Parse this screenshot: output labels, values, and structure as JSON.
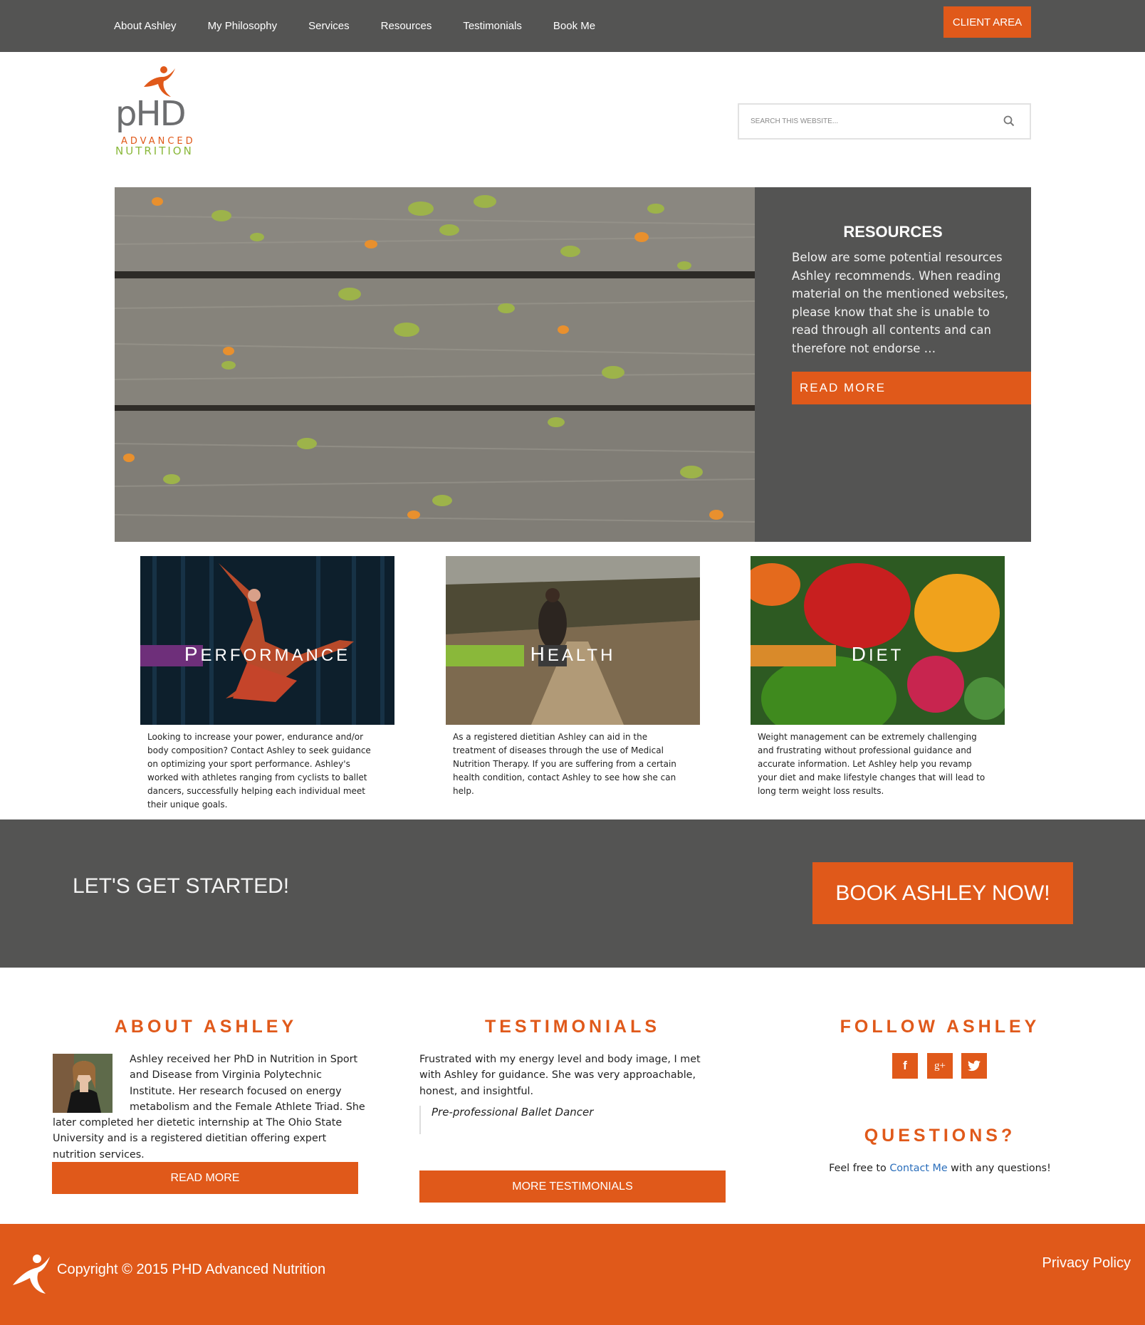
{
  "nav": {
    "items": [
      {
        "label": "About Ashley"
      },
      {
        "label": "My Philosophy"
      },
      {
        "label": "Services"
      },
      {
        "label": "Resources"
      },
      {
        "label": "Testimonials"
      },
      {
        "label": "Book Me"
      }
    ],
    "client_area": "CLIENT AREA"
  },
  "logo": {
    "line1": "pHD",
    "line2": "ADVANCED",
    "line3": "NUTRITION"
  },
  "search": {
    "placeholder": "SEARCH THIS WEBSITE..."
  },
  "hero": {
    "title": "RESOURCES",
    "text": "Below are some potential resources Ashley recommends. When reading material on the mentioned websites, please know that she is unable to read through all contents and can therefore not endorse …",
    "button": "READ MORE"
  },
  "cards": [
    {
      "label_first": "P",
      "label_rest": "ERFORMANCE",
      "text": "Looking to increase your power, endurance and/or body composition? Contact Ashley to seek guidance on optimizing your sport performance. Ashley's worked with athletes ranging from cyclists to ballet dancers, successfully helping each individual meet their unique goals."
    },
    {
      "label_first": "H",
      "label_rest": "EALTH",
      "text": "As a registered dietitian Ashley can aid in the treatment of diseases through the use of Medical Nutrition Therapy. If you are suffering from a certain health condition, contact Ashley to see how she can help."
    },
    {
      "label_first": "D",
      "label_rest": "IET",
      "text": "Weight management can be extremely challenging and frustrating without professional guidance and accurate information. Let Ashley help you revamp your diet and make lifestyle changes that will lead to long term weight loss results."
    }
  ],
  "cta": {
    "title": "LET'S GET STARTED!",
    "button": "BOOK ASHLEY NOW!"
  },
  "about": {
    "title": "ABOUT ASHLEY",
    "text": "Ashley received her PhD in Nutrition in Sport and Disease from Virginia Polytechnic Institute. Her research focused on energy metabolism and the Female Athlete Triad. She later completed her dietetic internship at The Ohio State University and is a registered dietitian offering expert nutrition services.",
    "button": "READ MORE"
  },
  "testimonials": {
    "title": "TESTIMONIALS",
    "quote": "Frustrated with my energy level and body image, I met with Ashley for guidance. She was very approachable, honest, and insightful.",
    "cite": "Pre-professional Ballet Dancer",
    "button": "MORE TESTIMONIALS"
  },
  "follow": {
    "title": "FOLLOW ASHLEY",
    "icons": [
      "facebook-icon",
      "google-plus-icon",
      "twitter-icon"
    ],
    "fb": "f",
    "gp": "g+"
  },
  "questions": {
    "title": "QUESTIONS?",
    "before": "Feel free to ",
    "link": "Contact Me",
    "after": " with any questions!"
  },
  "footer": {
    "copyright": "Copyright © 2015 PHD Advanced Nutrition",
    "privacy": "Privacy Policy"
  },
  "colors": {
    "accent": "#e0591a",
    "dark": "#545453",
    "purple": "#6e2f7a",
    "green": "#8ab83a",
    "orange_band": "#d98a2a"
  }
}
